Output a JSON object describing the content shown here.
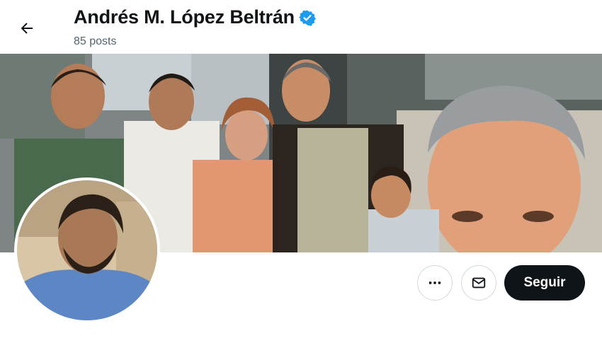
{
  "header": {
    "back_icon": "arrow-left-icon",
    "name": "Andrés M. López Beltrán",
    "verified_icon": "verified-badge-icon",
    "verified_color": "#1d9bf0",
    "posts": "85 posts"
  },
  "banner": {
    "description_icon": "banner-photo"
  },
  "avatar": {
    "icon": "profile-photo"
  },
  "actions": {
    "more_icon": "more-horizontal-icon",
    "message_icon": "mail-icon",
    "follow_label": "Seguir"
  },
  "colors": {
    "text": "#0f1419",
    "muted": "#536471",
    "border": "#cfd9de",
    "follow_bg": "#0f1419"
  }
}
